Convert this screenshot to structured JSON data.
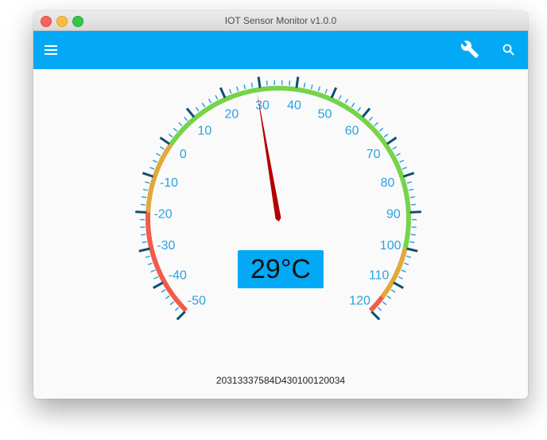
{
  "window": {
    "title": "IOT Sensor Monitor v1.0.0"
  },
  "appbar": {
    "color": "#03a9f4",
    "left_icon": "hamburger-menu-icon",
    "right_icons": [
      "wrench-icon",
      "search-icon"
    ]
  },
  "gauge": {
    "min": -50,
    "max": 120,
    "major_step": 10,
    "minor_divisions": 5,
    "tick_labels": [
      "-50",
      "-40",
      "-30",
      "-20",
      "-10",
      "0",
      "10",
      "20",
      "30",
      "40",
      "50",
      "60",
      "70",
      "80",
      "90",
      "100",
      "110",
      "120"
    ],
    "value": 29,
    "readout": "29°C",
    "color_bands": [
      {
        "from": -50,
        "to": -20,
        "color": "#f25b4a"
      },
      {
        "from": -20,
        "to": 0,
        "color": "#e0a93a"
      },
      {
        "from": 0,
        "to": 100,
        "color": "#76d34a"
      },
      {
        "from": 100,
        "to": 115,
        "color": "#e0a93a"
      },
      {
        "from": 115,
        "to": 120,
        "color": "#f25b4a"
      }
    ],
    "needle_color": "#b30000",
    "label_color": "#2aa1e3",
    "tick_color": "#0d4f74"
  },
  "serial": "20313337584D430100120034"
}
